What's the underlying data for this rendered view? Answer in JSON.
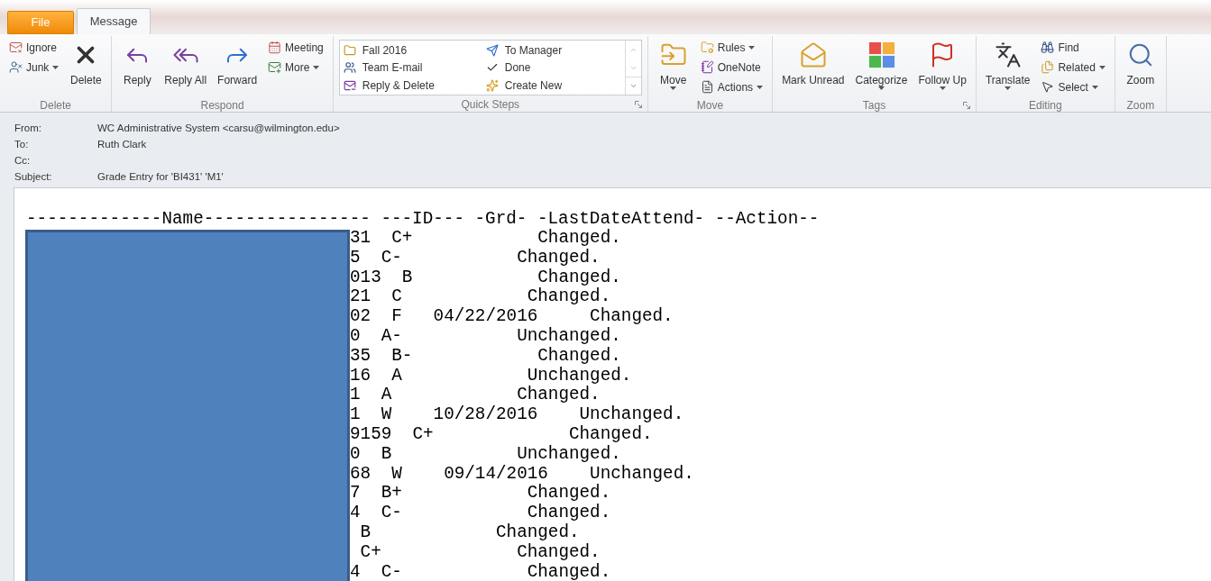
{
  "tabs": [
    {
      "label": "File",
      "kind": "file",
      "selected": false
    },
    {
      "label": "Message",
      "kind": "tab",
      "selected": true
    }
  ],
  "ribbon": {
    "groups": [
      {
        "label": "Delete",
        "controls": [
          {
            "kind": "small",
            "label": "Ignore"
          },
          {
            "kind": "small",
            "label": "Junk",
            "dropdown": true
          },
          {
            "kind": "large",
            "label": "Delete"
          }
        ]
      },
      {
        "label": "Respond",
        "controls": [
          {
            "kind": "large",
            "label": "Reply"
          },
          {
            "kind": "large",
            "label": "Reply All"
          },
          {
            "kind": "large",
            "label": "Forward"
          },
          {
            "kind": "small",
            "label": "Meeting"
          },
          {
            "kind": "small",
            "label": "More",
            "dropdown": true
          }
        ]
      },
      {
        "label": "Quick Steps",
        "launcher": true,
        "controls": [
          {
            "kind": "gallery",
            "items": [
              "Fall 2016",
              "Team E-mail",
              "Reply & Delete",
              "To Manager",
              "Done",
              "Create New"
            ]
          }
        ]
      },
      {
        "label": "Move",
        "controls": [
          {
            "kind": "large",
            "label": "Move",
            "dropdown": true
          },
          {
            "kind": "small",
            "label": "Rules",
            "dropdown": true
          },
          {
            "kind": "small",
            "label": "OneNote"
          },
          {
            "kind": "small",
            "label": "Actions",
            "dropdown": true
          }
        ]
      },
      {
        "label": "Tags",
        "launcher": true,
        "controls": [
          {
            "kind": "large",
            "label": "Mark Unread"
          },
          {
            "kind": "large",
            "label": "Categorize",
            "dropdown": true
          },
          {
            "kind": "large",
            "label": "Follow Up",
            "dropdown": true
          }
        ]
      },
      {
        "label": "Editing",
        "controls": [
          {
            "kind": "large",
            "label": "Translate",
            "dropdown": true
          },
          {
            "kind": "small",
            "label": "Find"
          },
          {
            "kind": "small",
            "label": "Related",
            "dropdown": true
          },
          {
            "kind": "small",
            "label": "Select",
            "dropdown": true
          }
        ]
      },
      {
        "label": "Zoom",
        "controls": [
          {
            "kind": "large",
            "label": "Zoom"
          }
        ]
      }
    ]
  },
  "headers": [
    {
      "label": "From:",
      "value": "WC Administrative System <carsu@wilmington.edu>"
    },
    {
      "label": "To:",
      "value": "Ruth Clark"
    },
    {
      "label": "Cc:"
    },
    {
      "label": "Subject:",
      "value": "Grade Entry for 'BI431' 'M1'"
    }
  ],
  "body": {
    "header_line": "-------------Name---------------- ---ID--- -Grd- -LastDateAttend- --Action--",
    "rows": [
      "31  C+            Changed.",
      "5  C-           Changed.",
      "013  B            Changed.",
      "21  C            Changed.",
      "02  F   04/22/2016     Changed.",
      "0  A-           Unchanged.",
      "35  B-            Changed.",
      "16  A            Unchanged.",
      "1  A            Changed.",
      "1  W    10/28/2016    Unchanged.",
      "9159  C+             Changed.",
      "0  B            Unchanged.",
      "68  W    09/14/2016    Unchanged.",
      "7  B+            Changed.",
      "4  C-            Changed.",
      " B            Changed.",
      " C+             Changed.",
      "4  C-            Changed."
    ]
  }
}
